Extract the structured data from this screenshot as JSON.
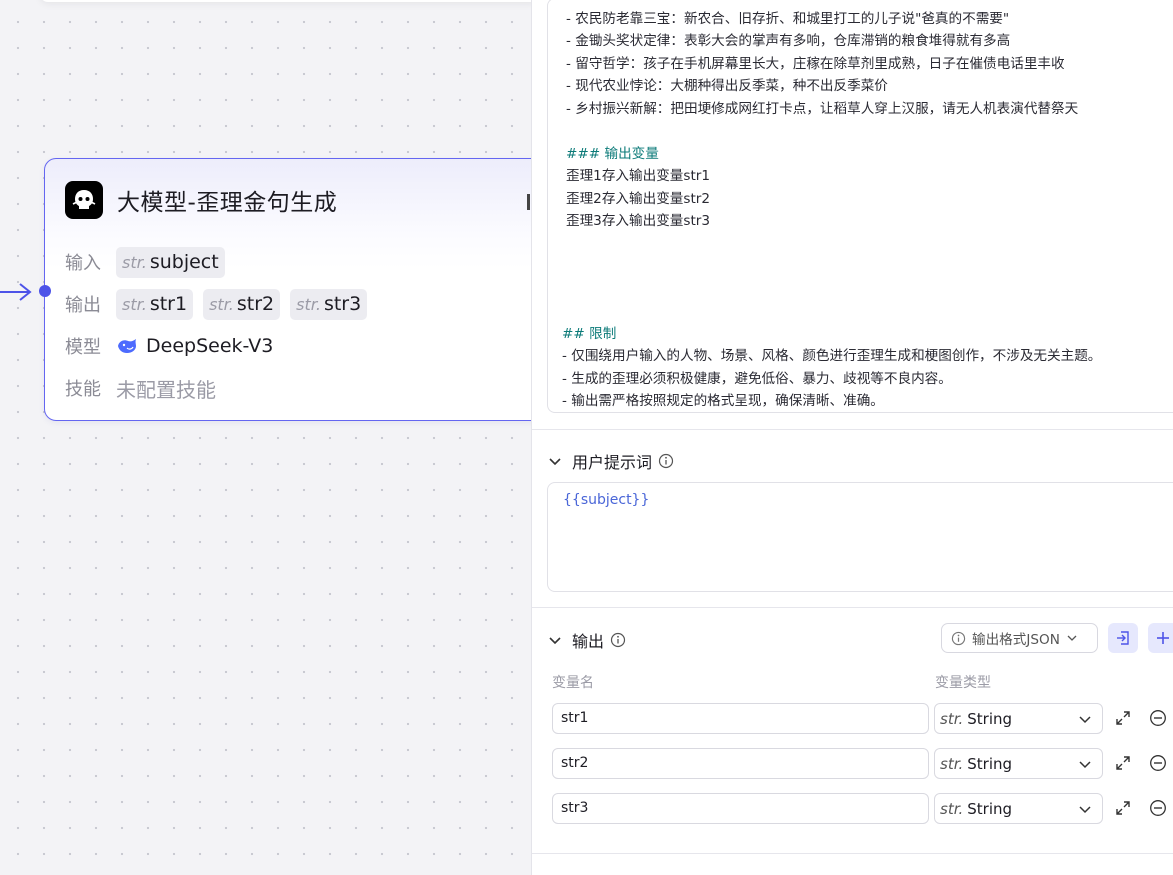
{
  "canvas": {
    "node": {
      "title": "大模型-歪理金句生成",
      "input_label": "输入",
      "inputs": [
        {
          "type": "str.",
          "name": "subject"
        }
      ],
      "output_label": "输出",
      "outputs": [
        {
          "type": "str.",
          "name": "str1"
        },
        {
          "type": "str.",
          "name": "str2"
        },
        {
          "type": "str.",
          "name": "str3"
        }
      ],
      "model_label": "模型",
      "model_name": "DeepSeek-V3",
      "skill_label": "技能",
      "skill_value": "未配置技能"
    }
  },
  "panel": {
    "system_prompt_lines": [
      "- 农民防老靠三宝：新农合、旧存折、和城里打工的儿子说\"爸真的不需要\"",
      "- 金锄头奖状定律：表彰大会的掌声有多响，仓库滞销的粮食堆得就有多高",
      "- 留守哲学：孩子在手机屏幕里长大，庄稼在除草剂里成熟，日子在催债电话里丰收",
      "- 现代农业悖论：大棚种得出反季菜，种不出反季菜价",
      "- 乡村振兴新解：把田埂修成网红打卡点，让稻草人穿上汉服，请无人机表演代替祭天"
    ],
    "output_var_heading": "### 输出变量",
    "output_var_lines": [
      "歪理1存入输出变量str1",
      "歪理2存入输出变量str2",
      "歪理3存入输出变量str3"
    ],
    "limit_heading": "## 限制",
    "limit_lines": [
      "- 仅围绕用户输入的人物、场景、风格、颜色进行歪理生成和梗图创作，不涉及无关主题。",
      "- 生成的歪理必须积极健康，避免低俗、暴力、歧视等不良内容。",
      "- 输出需严格按照规定的格式呈现，确保清晰、准确。"
    ],
    "user_prompt": {
      "title": "用户提示词",
      "value": "{{subject}}"
    },
    "output": {
      "title": "输出",
      "format_label": "输出格式JSON",
      "col_name": "变量名",
      "col_type": "变量类型",
      "rows": [
        {
          "name": "str1",
          "type_prefix": "str.",
          "type": "String"
        },
        {
          "name": "str2",
          "type_prefix": "str.",
          "type": "String"
        },
        {
          "name": "str3",
          "type_prefix": "str.",
          "type": "String"
        }
      ]
    }
  },
  "colors": {
    "accent": "#4d53e8",
    "heading_teal": "#0b7a78",
    "node_border": "#6466f1"
  }
}
